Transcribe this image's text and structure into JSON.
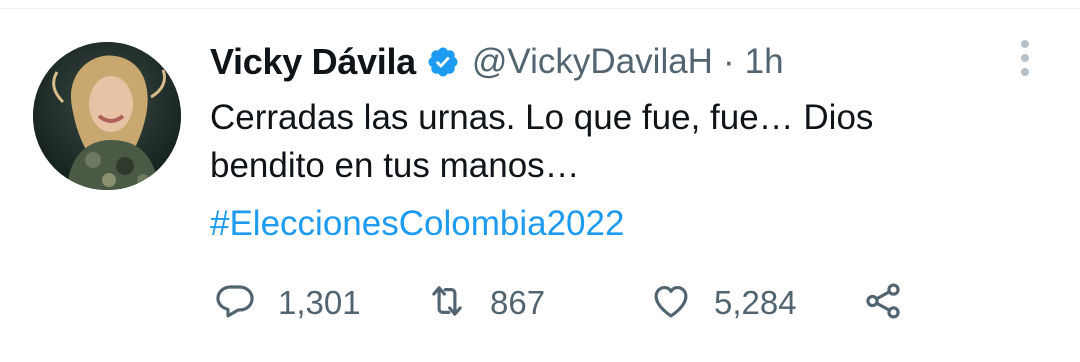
{
  "tweet": {
    "author": {
      "display_name": "Vicky Dávila",
      "handle": "@VickyDavilaH",
      "verified": true,
      "verified_color": "#1d9bf0"
    },
    "separator": "·",
    "timestamp": "1h",
    "text_lines": [
      "Cerradas las urnas. Lo que fue, fue… Dios",
      "bendito en tus manos…"
    ],
    "hashtag": "#EleccionesColombia2022",
    "hashtag_color": "#1d9bf0",
    "actions": {
      "reply": {
        "icon": "reply-icon",
        "count": "1,301"
      },
      "retweet": {
        "icon": "retweet-icon",
        "count": "867"
      },
      "like": {
        "icon": "heart-icon",
        "count": "5,284"
      },
      "share": {
        "icon": "share-icon"
      }
    },
    "menu_icon": "more-vertical-icon"
  }
}
